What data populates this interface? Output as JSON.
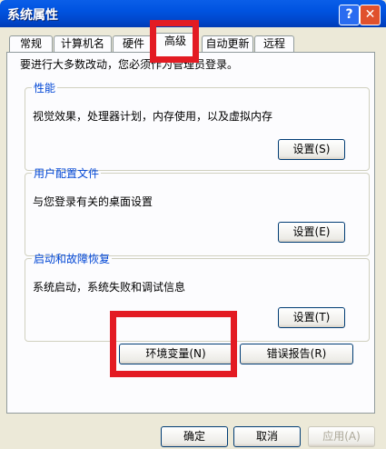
{
  "window": {
    "title": "系统属性",
    "help_label": "?",
    "close_label": "✕"
  },
  "tabs": [
    "常规",
    "计算机名",
    "硬件",
    "高级",
    "自动更新",
    "远程"
  ],
  "instruction": "要进行大多数改动，您必须作为管理员登录。",
  "groups": [
    {
      "title": "性能",
      "description": "视觉效果，处理器计划，内存使用，以及虚拟内存",
      "button": "设置(S)"
    },
    {
      "title": "用户配置文件",
      "description": "与您登录有关的桌面设置",
      "button": "设置(E)"
    },
    {
      "title": "启动和故障恢复",
      "description": "系统启动，系统失败和调试信息",
      "button": "设置(T)"
    }
  ],
  "env_button": "环境变量(N)",
  "error_button": "错误报告(R)",
  "footer": {
    "ok": "确定",
    "cancel": "取消",
    "apply": "应用(A)"
  },
  "colors": {
    "highlight": "#e31b23",
    "title_bar": "#0053e0",
    "group_title": "#0046d5"
  }
}
